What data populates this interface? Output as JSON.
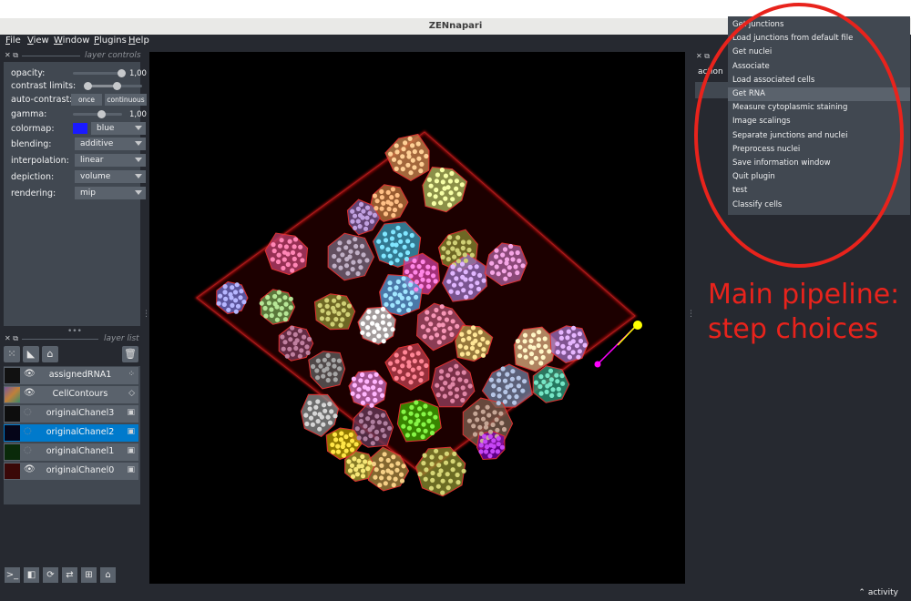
{
  "window": {
    "title": "ZENnapari"
  },
  "menu": [
    {
      "key": "F",
      "rest": "ile"
    },
    {
      "key": "V",
      "rest": "iew"
    },
    {
      "key": "W",
      "rest": "indow"
    },
    {
      "key": "P",
      "rest": "lugins"
    },
    {
      "key": "H",
      "rest": "elp"
    }
  ],
  "layer_controls": {
    "title": "layer controls",
    "opacity": {
      "label": "opacity:",
      "value": "1,00",
      "level": 1.0
    },
    "contrast_limits": {
      "label": "contrast limits:"
    },
    "auto_contrast": {
      "label": "auto-contrast:",
      "once": "once",
      "continuous": "continuous"
    },
    "gamma": {
      "label": "gamma:",
      "value": "1,00",
      "level": 0.5
    },
    "colormap": {
      "label": "colormap:",
      "value": "blue",
      "swatch": "#1a1aff"
    },
    "blending": {
      "label": "blending:",
      "value": "additive"
    },
    "interpolation": {
      "label": "interpolation:",
      "value": "linear"
    },
    "depiction": {
      "label": "depiction:",
      "value": "volume"
    },
    "rendering": {
      "label": "rendering:",
      "value": "mip"
    }
  },
  "layer_list": {
    "title": "layer list",
    "layers": [
      {
        "name": "assignedRNA1",
        "type": "points",
        "visible": true,
        "selected": false
      },
      {
        "name": "CellContours",
        "type": "shapes",
        "visible": true,
        "selected": false
      },
      {
        "name": "originalChanel3",
        "type": "image",
        "visible": false,
        "selected": false
      },
      {
        "name": "originalChanel2",
        "type": "image",
        "visible": false,
        "selected": true
      },
      {
        "name": "originalChanel1",
        "type": "image",
        "visible": false,
        "selected": false
      },
      {
        "name": "originalChanel0",
        "type": "image",
        "visible": true,
        "selected": false
      }
    ]
  },
  "right_panel": {
    "partial_label": "action"
  },
  "plugin_menu": {
    "items": [
      "Get junctions",
      "Load junctions from default file",
      "Get nuclei",
      "Associate",
      "Load associated cells",
      "Get RNA",
      "Measure cytoplasmic staining",
      "Image scalings",
      "Separate junctions and nuclei",
      "Preprocess nuclei",
      "Save information window",
      "Quit plugin",
      "test",
      "Classify cells"
    ],
    "highlighted": "Get RNA"
  },
  "annotation": {
    "line1": "Main pipeline:",
    "line2": "step choices",
    "color": "#e8231c"
  },
  "status": {
    "activity": "activity"
  }
}
